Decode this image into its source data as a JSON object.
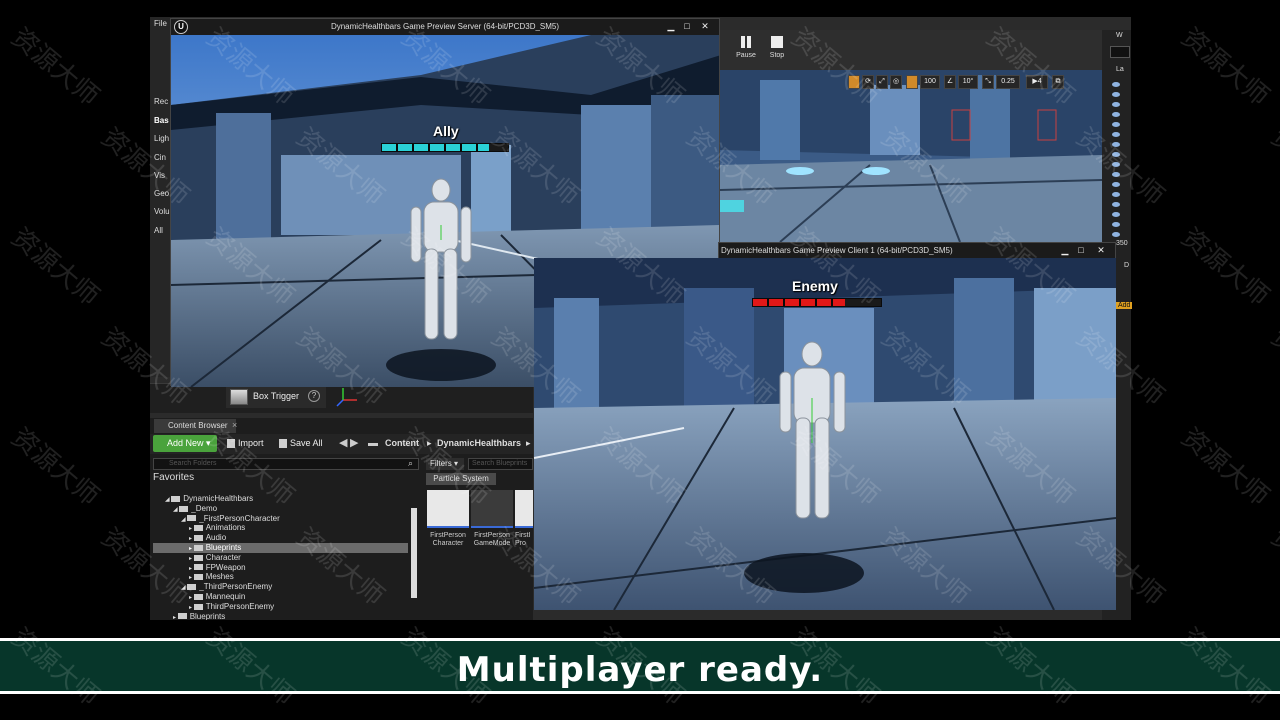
{
  "editor": {
    "menu_file": "File",
    "mode_labels": [
      "Rec",
      "Bas",
      "Ligh",
      "Cin",
      "Vis",
      "Geo",
      "Volu",
      "All"
    ],
    "selected_mode_index": 1,
    "box_trigger_label": "Box Trigger",
    "box_trigger_help": "?"
  },
  "content_browser": {
    "tab_label": "Content Browser",
    "tab_close": "×",
    "add_new_label": "Add New ▾",
    "import_label": "Import",
    "save_all_label": "Save All",
    "crumbs": [
      "Content",
      "DynamicHealthbars"
    ],
    "crumb_separator": "▸",
    "search_folders_placeholder": "Search Folders",
    "favorites_label": "Favorites",
    "filters_label": "Filters ▾",
    "search_blueprints_placeholder": "Search Blueprints",
    "filter_chip": "Particle System",
    "tree": [
      {
        "label": "DynamicHealthbars",
        "depth": 0,
        "open": true,
        "selected": false
      },
      {
        "label": "_Demo",
        "depth": 1,
        "open": true,
        "selected": false
      },
      {
        "label": "_FirstPersonCharacter",
        "depth": 2,
        "open": true,
        "selected": false
      },
      {
        "label": "Animations",
        "depth": 3,
        "open": false,
        "selected": false
      },
      {
        "label": "Audio",
        "depth": 3,
        "open": false,
        "selected": false
      },
      {
        "label": "Blueprints",
        "depth": 3,
        "open": false,
        "selected": true
      },
      {
        "label": "Character",
        "depth": 3,
        "open": false,
        "selected": false
      },
      {
        "label": "FPWeapon",
        "depth": 3,
        "open": false,
        "selected": false
      },
      {
        "label": "Meshes",
        "depth": 3,
        "open": false,
        "selected": false
      },
      {
        "label": "_ThirdPersonEnemy",
        "depth": 2,
        "open": true,
        "selected": false
      },
      {
        "label": "Mannequin",
        "depth": 3,
        "open": false,
        "selected": false
      },
      {
        "label": "ThirdPersonEnemy",
        "depth": 3,
        "open": false,
        "selected": false
      },
      {
        "label": "Blueprints",
        "depth": 1,
        "open": false,
        "selected": false
      }
    ],
    "assets": [
      {
        "label": "FirstPerson Character",
        "thumb": "light"
      },
      {
        "label": "FirstPerson GameMode",
        "thumb": "dark"
      },
      {
        "label": "FirstI Pro",
        "thumb": "light"
      }
    ]
  },
  "editor_toolbar": {
    "pause_label": "Pause",
    "stop_label": "Stop"
  },
  "viewport_tools": [
    "100",
    "10°",
    "0.25"
  ],
  "right_strip": {
    "w_label": "W",
    "la_label": "La",
    "num_label": "350",
    "d_label": "D",
    "add_label": "Add"
  },
  "server_window": {
    "title": "DynamicHealthbars Game Preview Server (64-bit/PCD3D_SM5)",
    "minimize": "▁",
    "maximize": "□",
    "close": "✕",
    "healthbar_label": "Ally",
    "health_fraction": 0.85,
    "health_color": "#2ad1d6"
  },
  "client_window": {
    "title": "DynamicHealthbars Game Preview Client 1 (64-bit/PCD3D_SM5)",
    "minimize": "▁",
    "maximize": "□",
    "close": "✕",
    "healthbar_label": "Enemy",
    "health_fraction": 0.72,
    "health_color": "#e01818"
  },
  "caption": "Multiplayer ready.",
  "watermark_text": "资源大师"
}
